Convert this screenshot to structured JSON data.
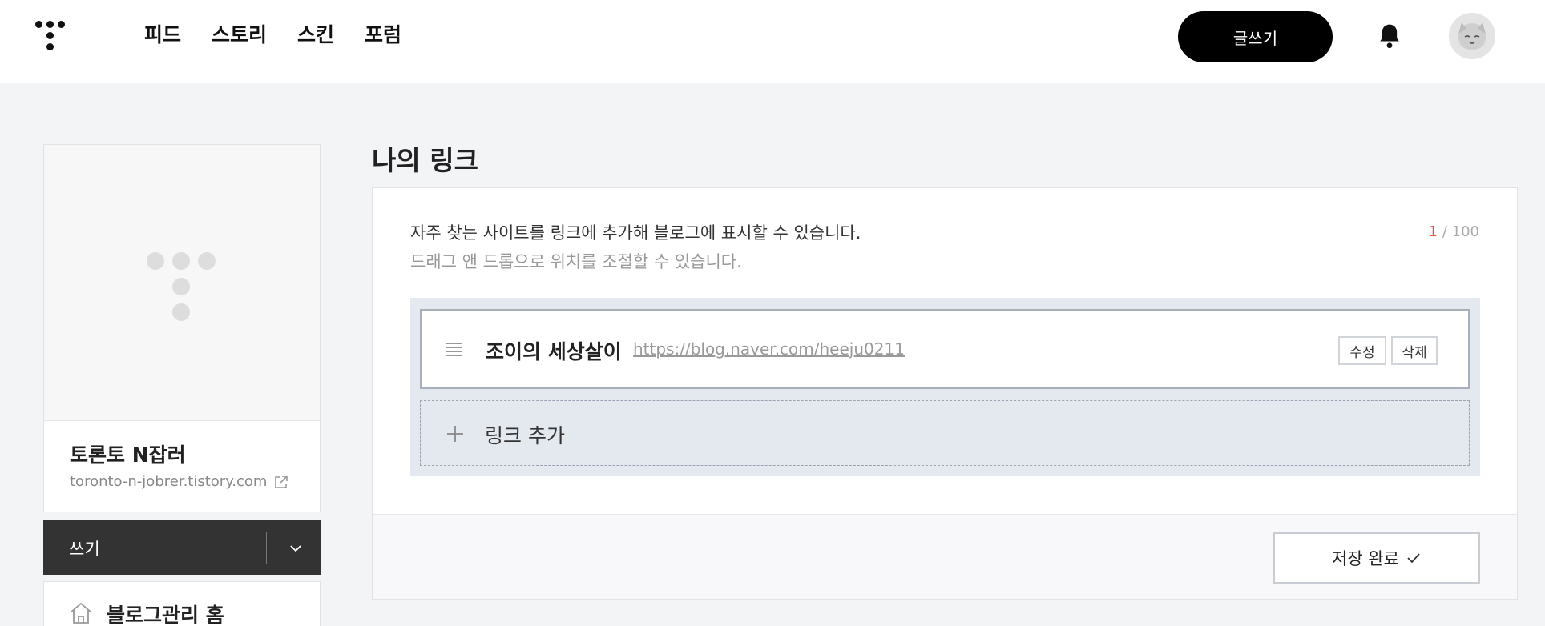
{
  "header": {
    "logo": "tistory-logo",
    "nav": [
      "피드",
      "스토리",
      "스킨",
      "포럼"
    ],
    "write_button": "글쓰기",
    "bell_icon": "bell-icon",
    "avatar_icon": "avatar-icon"
  },
  "sidebar": {
    "blog_name": "토론토 N잡러",
    "blog_url": "toronto-n-jobrer.tistory.com",
    "write_bar_label": "쓰기",
    "admin_home_label": "블로그관리 홈"
  },
  "main": {
    "title": "나의 링크",
    "description": "자주 찾는 사이트를 링크에 추가해 블로그에 표시할 수 있습니다.",
    "sub_description": "드래그 앤 드롭으로 위치를 조절할 수 있습니다.",
    "counter": {
      "current": "1",
      "max": "/ 100"
    },
    "links": [
      {
        "name": "조이의 세상살이",
        "url": "https://blog.naver.com/heeju0211",
        "edit_label": "수정",
        "delete_label": "삭제"
      }
    ],
    "add_link_label": "링크 추가",
    "save_button": "저장 완료"
  },
  "colors": {
    "accent_counter": "#e8533e",
    "write_button_bg": "#000000",
    "write_bar_bg": "#333333",
    "list_area_bg": "#e4e8ef"
  }
}
